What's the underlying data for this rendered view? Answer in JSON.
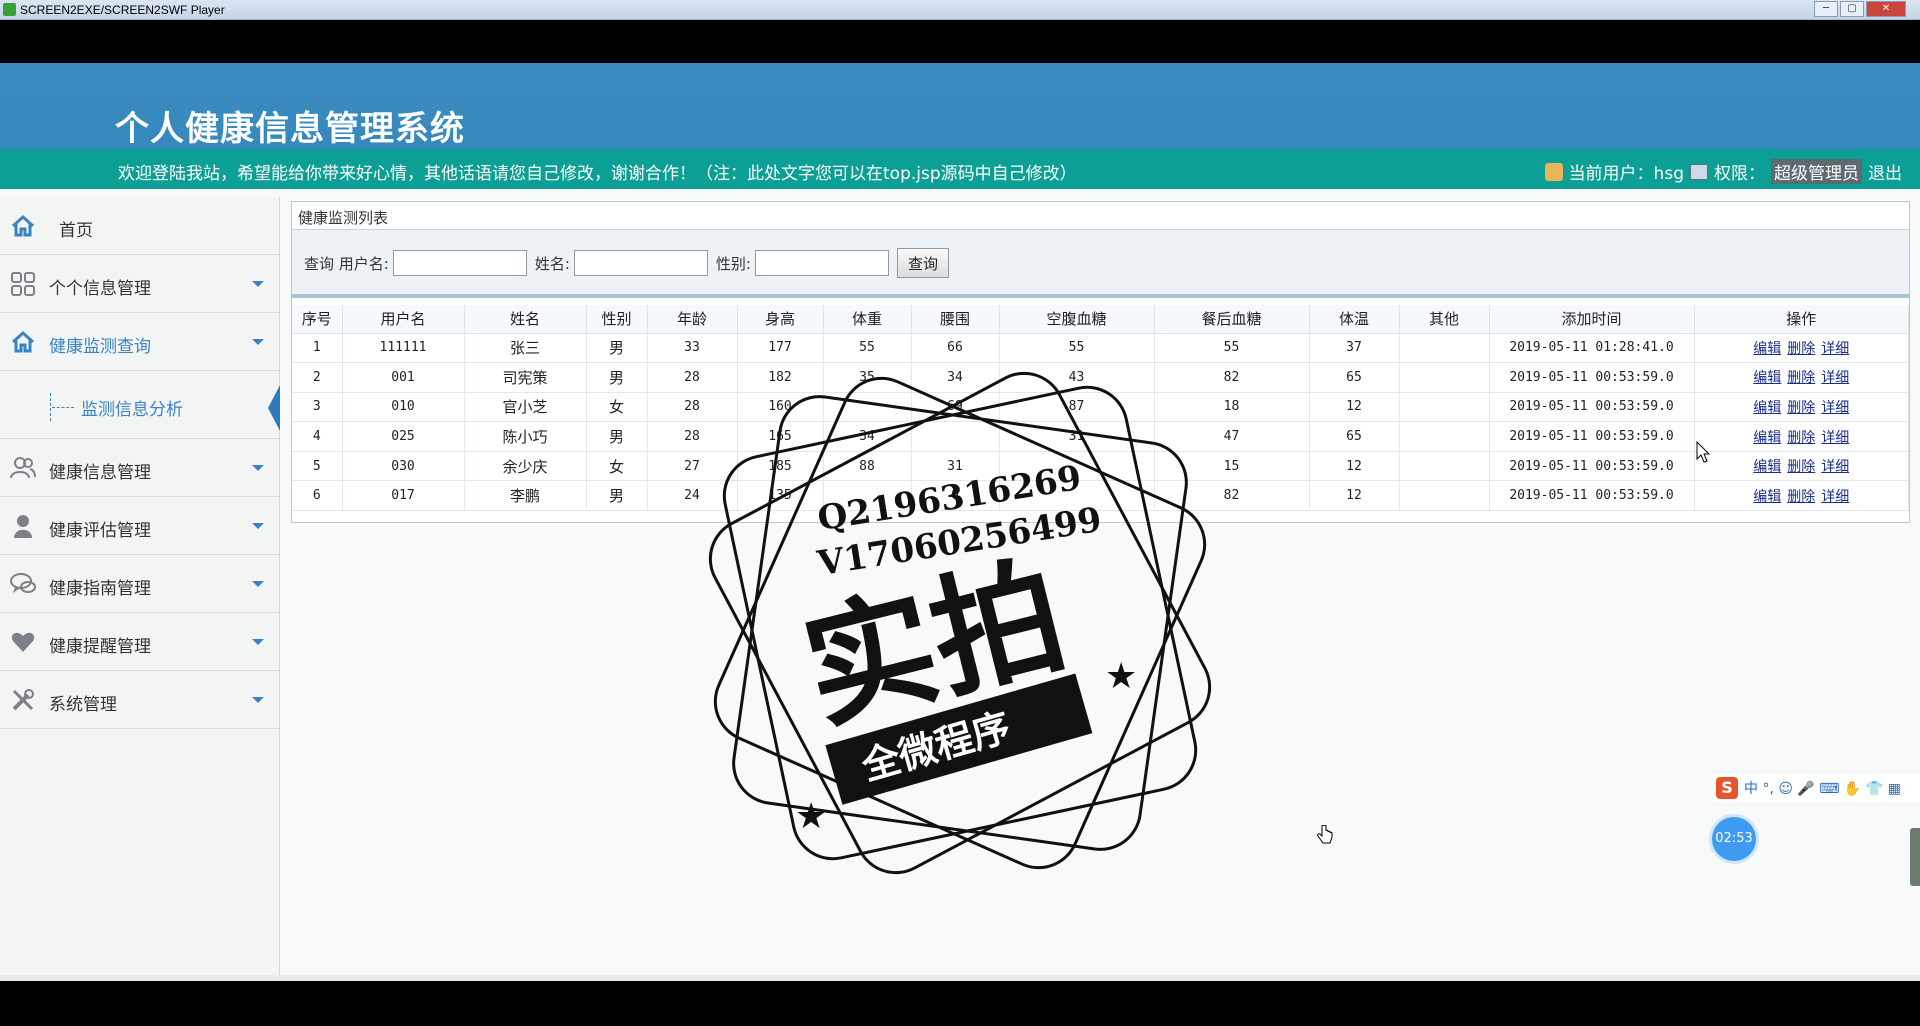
{
  "player": {
    "title": "SCREEN2EXE/SCREEN2SWF Player",
    "buttons": [
      "─",
      "▢",
      "✕"
    ]
  },
  "header": {
    "app_title": "个人健康信息管理系统",
    "welcome": "欢迎登陆我站，希望能给你带来好心情，其他话语请您自己修改，谢谢合作！（注：此处文字您可以在top.jsp源码中自己修改）",
    "current_user_label": "当前用户：hsg",
    "permission_label": "权限：",
    "role": "超级管理员",
    "logout": "退出"
  },
  "sidebar": {
    "items": [
      {
        "label": "首页",
        "icon": "home-icon"
      },
      {
        "label": "个个信息管理",
        "icon": "grid-icon"
      },
      {
        "label": "健康监测查询",
        "icon": "home-icon"
      },
      {
        "label": "监测信息分析"
      },
      {
        "label": "健康信息管理",
        "icon": "users-icon"
      },
      {
        "label": "健康评估管理",
        "icon": "user-icon"
      },
      {
        "label": "健康指南管理",
        "icon": "chat-icon"
      },
      {
        "label": "健康提醒管理",
        "icon": "heart-icon"
      },
      {
        "label": "系统管理",
        "icon": "tools-icon"
      }
    ]
  },
  "panel": {
    "title": "健康监测列表",
    "search": {
      "prefix": "查询",
      "username_label": "用户名:",
      "name_label": "姓名:",
      "gender_label": "性别:",
      "button": "查询"
    },
    "columns": [
      "序号",
      "用户名",
      "姓名",
      "性别",
      "年龄",
      "身高",
      "体重",
      "腰围",
      "空腹血糖",
      "餐后血糖",
      "体温",
      "其他",
      "添加时间",
      "操作"
    ],
    "rows": [
      [
        "1",
        "111111",
        "张三",
        "男",
        "33",
        "177",
        "55",
        "66",
        "55",
        "55",
        "37",
        "",
        "2019-05-11 01:28:41.0"
      ],
      [
        "2",
        "001",
        "司宪策",
        "男",
        "28",
        "182",
        "35",
        "34",
        "43",
        "82",
        "65",
        "",
        "2019-05-11 00:53:59.0"
      ],
      [
        "3",
        "010",
        "官小芝",
        "女",
        "28",
        "160",
        "",
        "69",
        "87",
        "18",
        "12",
        "",
        "2019-05-11 00:53:59.0"
      ],
      [
        "4",
        "025",
        "陈小巧",
        "男",
        "28",
        "165",
        "34",
        "",
        "31",
        "47",
        "65",
        "",
        "2019-05-11 00:53:59.0"
      ],
      [
        "5",
        "030",
        "余少庆",
        "女",
        "27",
        "185",
        "88",
        "31",
        "",
        "15",
        "12",
        "",
        "2019-05-11 00:53:59.0"
      ],
      [
        "6",
        "017",
        "李鹏",
        "男",
        "24",
        "135",
        "",
        "0",
        "",
        "82",
        "12",
        "",
        "2019-05-11 00:53:59.0"
      ]
    ],
    "ops": [
      "编辑",
      "删除",
      "详细"
    ]
  },
  "watermark": {
    "line1": "Q2196316269",
    "line2": "V17060256499",
    "big": "实拍",
    "ribbon": "全微程序"
  },
  "ime": {
    "logo": "S",
    "text": "中 °, ☺ 🎤 ⌨ ✋ 👕 ▦"
  },
  "timer": "02:53"
}
